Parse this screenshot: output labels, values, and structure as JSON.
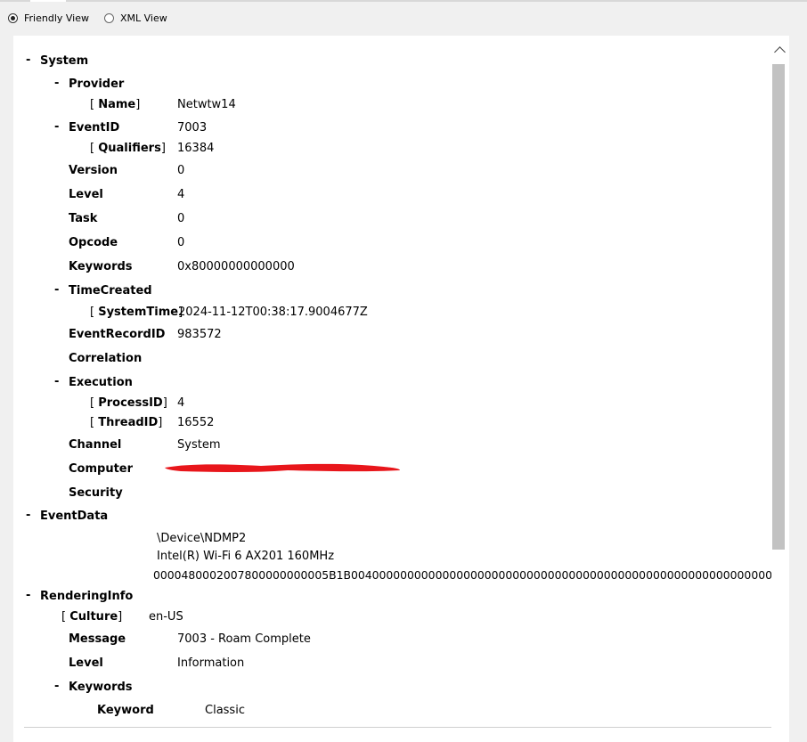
{
  "view_toggle": {
    "friendly_label": "Friendly View",
    "xml_label": "XML View",
    "selected": "Friendly View"
  },
  "tree": {
    "system": {
      "label": "System",
      "provider": {
        "label": "Provider",
        "name_key": "Name",
        "name_value": "Netwtw14"
      },
      "event_id": {
        "label": "EventID",
        "value": "7003",
        "qualifiers_key": "Qualifiers",
        "qualifiers_value": "16384"
      },
      "version": {
        "label": "Version",
        "value": "0"
      },
      "level": {
        "label": "Level",
        "value": "4"
      },
      "task": {
        "label": "Task",
        "value": "0"
      },
      "opcode": {
        "label": "Opcode",
        "value": "0"
      },
      "keywords": {
        "label": "Keywords",
        "value": "0x80000000000000"
      },
      "time_created": {
        "label": "TimeCreated",
        "system_time_key": "SystemTime",
        "system_time_value": "2024-11-12T00:38:17.9004677Z"
      },
      "event_record_id": {
        "label": "EventRecordID",
        "value": "983572"
      },
      "correlation": {
        "label": "Correlation"
      },
      "execution": {
        "label": "Execution",
        "process_id_key": "ProcessID",
        "process_id_value": "4",
        "thread_id_key": "ThreadID",
        "thread_id_value": "16552"
      },
      "channel": {
        "label": "Channel",
        "value": "System"
      },
      "computer": {
        "label": "Computer",
        "value_redacted": true
      },
      "security": {
        "label": "Security"
      }
    },
    "event_data": {
      "label": "EventData",
      "lines": [
        "\\Device\\NDMP2",
        "Intel(R) Wi-Fi 6 AX201 160MHz",
        "0000480002007800000000005B1B004000000000000000000000000000000000000000000000000000000000"
      ]
    },
    "rendering_info": {
      "label": "RenderingInfo",
      "culture_key": "Culture",
      "culture_value": "en-US",
      "message": {
        "label": "Message",
        "value": "7003 - Roam Complete"
      },
      "level": {
        "label": "Level",
        "value": "Information"
      },
      "keywords": {
        "label": "Keywords",
        "keyword_label": "Keyword",
        "keyword_value": "Classic"
      }
    }
  },
  "toggle_symbol": "-",
  "colors": {
    "redaction": "#e8161b",
    "scroll_thumb": "#c2c2c2",
    "background": "#f0f0f0"
  }
}
